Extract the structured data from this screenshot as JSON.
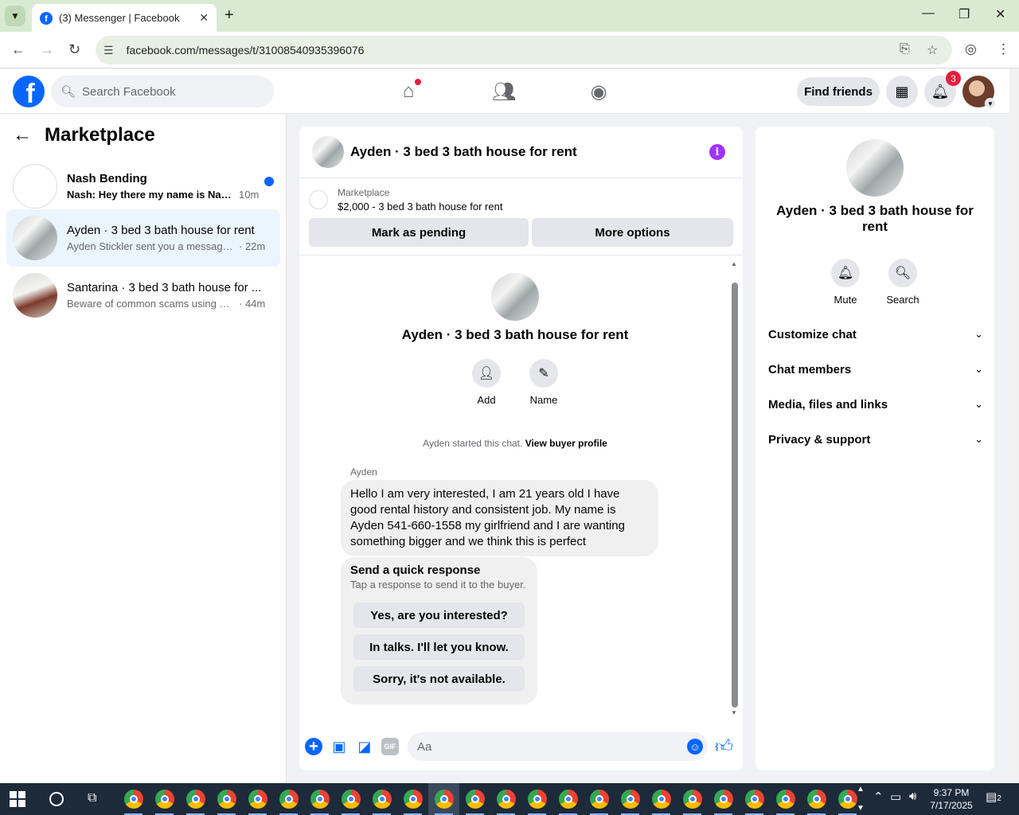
{
  "browser": {
    "tab_title": "(3) Messenger | Facebook",
    "url": "facebook.com/messages/t/31008540935396076",
    "new_tab": "+",
    "close_tab": "✕"
  },
  "fb": {
    "search_placeholder": "Search Facebook",
    "find_friends": "Find friends",
    "notif_count": "3"
  },
  "left": {
    "title": "Marketplace",
    "conversations": [
      {
        "name": "Nash Bending",
        "preview": "Nash: Hey there my name is Nas...",
        "time": "10m",
        "unread": true
      },
      {
        "name": "Ayden · 3 bed 3 bath house for rent",
        "preview": "Ayden Stickler sent you a message a...",
        "time": "· 22m",
        "active": true
      },
      {
        "name": "Santarina · 3 bed 3 bath house for ...",
        "preview": "Beware of common scams using pa...",
        "time": "· 44m"
      }
    ]
  },
  "chat": {
    "title": "Ayden · 3 bed 3 bath house for rent",
    "listing_source": "Marketplace",
    "listing_text": "$2,000 - 3 bed 3 bath house for rent",
    "mark_pending": "Mark as pending",
    "more_options": "More options",
    "intro_title": "Ayden · 3 bed 3 bath house for rent",
    "add_label": "Add",
    "name_label": "Name",
    "started_text": "Ayden started this chat.",
    "view_profile": "View buyer profile",
    "sender": "Ayden",
    "message": "Hello I am very interested, I am 21 years old I have good rental history and consistent job. My name is Ayden 541-660-1558 my girlfriend and I are wanting something bigger and we think this is perfect",
    "quick_title": "Send a quick response",
    "quick_sub": "Tap a response to send it to the buyer.",
    "quick_responses": [
      "Yes, are you interested?",
      "In talks. I'll let you know.",
      "Sorry, it's not available."
    ],
    "composer_placeholder": "Aa",
    "gif": "GIF"
  },
  "right": {
    "title": "Ayden · 3 bed 3 bath house for rent",
    "mute": "Mute",
    "search": "Search",
    "sections": [
      "Customize chat",
      "Chat members",
      "Media, files and links",
      "Privacy & support"
    ]
  },
  "taskbar": {
    "time": "9:37 PM",
    "date": "7/17/2025",
    "notif_count": "2"
  },
  "colors": {
    "accent": "#0866ff",
    "info": "#a033ff",
    "badge": "#e41e3f"
  }
}
